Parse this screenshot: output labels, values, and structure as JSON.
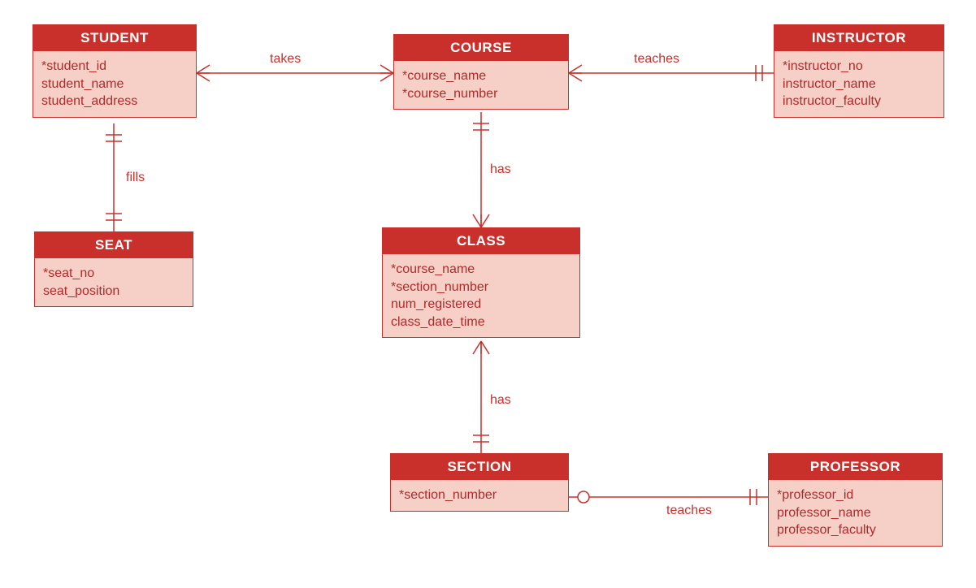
{
  "entities": {
    "student": {
      "title": "STUDENT",
      "attrs": [
        "*student_id",
        "student_name",
        "student_address"
      ]
    },
    "course": {
      "title": "COURSE",
      "attrs": [
        "*course_name",
        "*course_number"
      ]
    },
    "instructor": {
      "title": "INSTRUCTOR",
      "attrs": [
        "*instructor_no",
        "instructor_name",
        "instructor_faculty"
      ]
    },
    "seat": {
      "title": "SEAT",
      "attrs": [
        "*seat_no",
        "seat_position"
      ]
    },
    "class": {
      "title": "CLASS",
      "attrs": [
        "*course_name",
        "*section_number",
        "num_registered",
        "class_date_time"
      ]
    },
    "section": {
      "title": "SECTION",
      "attrs": [
        "*section_number"
      ]
    },
    "professor": {
      "title": "PROFESSOR",
      "attrs": [
        "*professor_id",
        "professor_name",
        "professor_faculty"
      ]
    }
  },
  "relationships": {
    "takes": "takes",
    "teaches_instructor": "teaches",
    "fills": "fills",
    "has_class": "has",
    "has_section": "has",
    "teaches_professor": "teaches"
  },
  "colors": {
    "header_bg": "#c9302c",
    "body_bg": "#f6cfc7",
    "line": "#c9302c",
    "text": "#b12a2a"
  }
}
